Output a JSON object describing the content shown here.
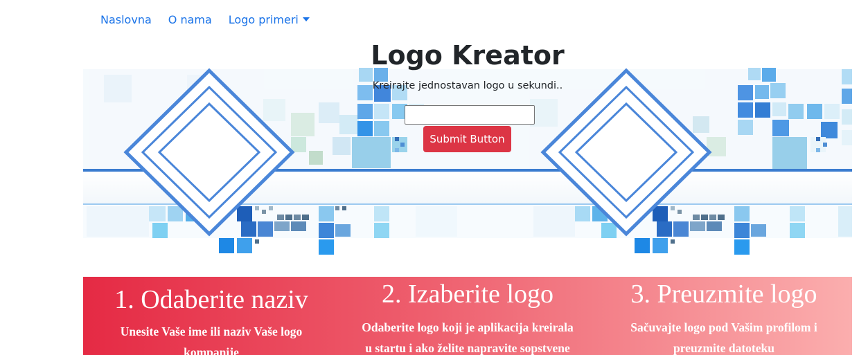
{
  "nav": {
    "items": [
      {
        "label": "Naslovna"
      },
      {
        "label": "O nama"
      },
      {
        "label": "Logo primeri"
      }
    ],
    "dropdown_icon": "caret-down-icon",
    "link_color": "#1a73e8"
  },
  "hero": {
    "title": "Logo Kreator",
    "subtitle": "Kreirajte jednostavan logo u sekundi..",
    "input": {
      "value": "",
      "placeholder": ""
    },
    "submit_label": "Submit Button",
    "submit_color": "#dc3545",
    "decoration": "blue-pixel-diamond-pattern"
  },
  "steps": [
    {
      "title": "1. Odaberite naziv",
      "text": "Unesite Vaše ime ili naziv Vaše logo kompanije"
    },
    {
      "title": "2. Izaberite logo",
      "text": "Odaberite logo koji je aplikacija kreirala u startu i ako želite napravite sopstvene"
    },
    {
      "title": "3. Preuzmite logo",
      "text": "Sačuvajte logo pod Vašim profilom i preuzmite datoteku"
    }
  ],
  "steps_gradient": [
    "#e52a44",
    "#ee5f6e",
    "#fbaeae"
  ]
}
